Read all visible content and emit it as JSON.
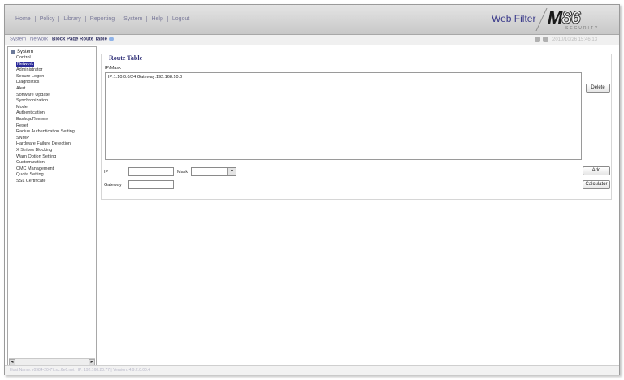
{
  "menu": {
    "items": [
      "Home",
      "Policy",
      "Library",
      "Reporting",
      "System",
      "Help",
      "Logout"
    ]
  },
  "product": {
    "name": "Web Filter",
    "logo_text": "M86",
    "logo_tagline": "SECURITY"
  },
  "breadcrumb": {
    "path": "System : Network : ",
    "current": "Block Page Route Table"
  },
  "toolbar": {
    "clock": "2010/10/26 15:46:13"
  },
  "sidebar": {
    "root": "System",
    "items": [
      "Control",
      "Network",
      "Administrator",
      "Secure Logon",
      "Diagnostics",
      "Alert",
      "Software Update",
      "Synchronization",
      "Mode",
      "Authentication",
      "Backup/Restore",
      "Reset",
      "Radius Authentication Setting",
      "SNMP",
      "Hardware Failure Detection",
      "X Strikes Blocking",
      "Warn Option Setting",
      "Customization",
      "CMC Management",
      "Quota Setting",
      "SSL Certificate"
    ],
    "selected": "Network"
  },
  "route_table": {
    "title": "Route Table",
    "column_label": "IP/Mask",
    "entries": [
      "IP:1.10.0.0/24 Gateway:192.168.10.0"
    ],
    "delete_label": "Delete"
  },
  "form": {
    "ip_label": "IP",
    "ip_value": "",
    "mask_label": "Mask",
    "mask_value": "",
    "gateway_label": "Gateway",
    "gateway_value": "",
    "add_label": "Add",
    "calculator_label": "Calculator"
  },
  "status": {
    "text": "Host Name: r0984-20-77.sc.6e6.net  |  IP: 192.168.20.77  |  Version: 4.9.2.0.00.4"
  }
}
